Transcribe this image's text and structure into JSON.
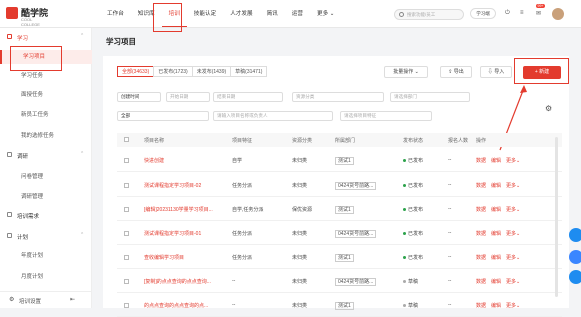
{
  "brand": {
    "name": "酷学院",
    "sub": "COOL COLLEGE"
  },
  "nav": {
    "items": [
      "工作台",
      "知识库",
      "培训",
      "技能认定",
      "人才发展",
      "简讯",
      "运营",
      "更多 ⌄"
    ],
    "active_index": 2
  },
  "header": {
    "search_placeholder": "搜索功能/员工",
    "study_label": "学习端",
    "badge_count": "99+"
  },
  "sidebar": {
    "group_learning": "学习",
    "items_learning": [
      "学习项目",
      "学习任务",
      "面授任务",
      "新员工任务",
      "我的选修任务"
    ],
    "group_survey": "调研",
    "items_survey": [
      "问卷管理",
      "调研管理"
    ],
    "item_demand": "培训需求",
    "group_plan": "计划",
    "items_plan": [
      "年度计划",
      "月度计划"
    ],
    "bottom": "培训设置"
  },
  "page": {
    "title": "学习项目"
  },
  "tabs": [
    {
      "label": "全部(34633)"
    },
    {
      "label": "已发布(1723)"
    },
    {
      "label": "未发布(1439)"
    },
    {
      "label": "草稿(31471)"
    }
  ],
  "actions": {
    "batch": "批量操作 ⌄",
    "export": "导出",
    "import": "导入",
    "new": "+ 新建"
  },
  "filters": {
    "time": "创建时间",
    "start_date": "开始日期",
    "end_date": "结束日期",
    "resource": "资源分类",
    "dept": "请选择部门",
    "all": "全部",
    "project_name": "请输入项目名称或负责人",
    "project_type": "请选择项目特征"
  },
  "table": {
    "headers": [
      "项目名称",
      "项目特征",
      "资源分类",
      "所属部门",
      "发布状态",
      "报名人数",
      "操作"
    ],
    "rows": [
      {
        "name": "快进创建",
        "feature": "自学",
        "res": "未归类",
        "dept": "测试1",
        "status": "已发布",
        "ops": [
          "数据",
          "编辑",
          "更多⌄"
        ]
      },
      {
        "name": "测试课程指定学习项目-02",
        "feature": "任务分派",
        "res": "未归类",
        "dept": "0424货号前路...",
        "status": "已发布",
        "ops": [
          "数据",
          "编辑",
          "更多⌄"
        ]
      },
      {
        "name": "[编辑]20231130学量学习项目...",
        "feature": "自学,任务分派",
        "res": "保优资源",
        "dept": "测试1",
        "status": "已发布",
        "ops": [
          "数据",
          "编辑",
          "更多⌄"
        ]
      },
      {
        "name": "测试课程指定学习项目-01",
        "feature": "任务分派",
        "res": "未归类",
        "dept": "0424货号前路...",
        "status": "已发布",
        "ops": [
          "数据",
          "编辑",
          "更多⌄"
        ]
      },
      {
        "name": "查收编辑学习项目",
        "feature": "任务分派",
        "res": "未归类",
        "dept": "测试1",
        "status": "已发布",
        "ops": [
          "数据",
          "编辑",
          "更多⌄"
        ]
      },
      {
        "name": "[复制]的点点查询的点点查询...",
        "feature": "--",
        "res": "未归类",
        "dept": "0424货号前路...",
        "status": "草稿",
        "ops": [
          "数据",
          "编辑",
          "更多⌄"
        ]
      },
      {
        "name": "的点点查询的点点查询的点...",
        "feature": "--",
        "res": "未归类",
        "dept": "测试1",
        "status": "草稿",
        "ops": [
          "数据",
          "编辑",
          "更多⌄"
        ]
      }
    ]
  }
}
